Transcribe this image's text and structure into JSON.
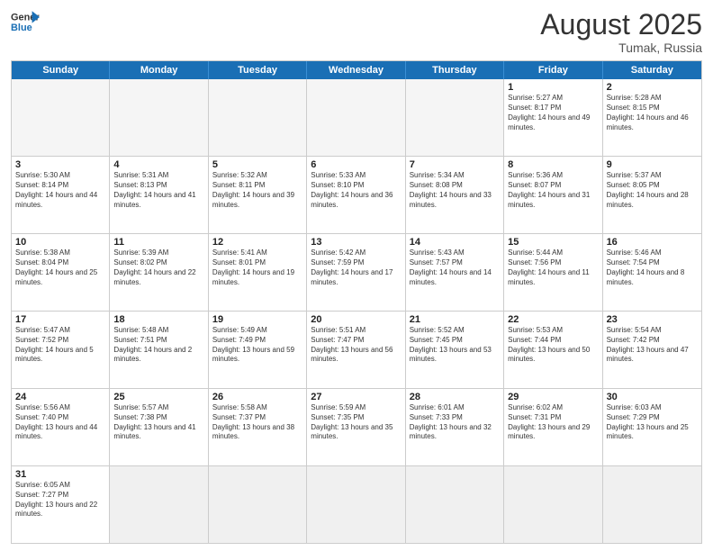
{
  "header": {
    "logo_general": "General",
    "logo_blue": "Blue",
    "month_title": "August 2025",
    "location": "Tumak, Russia"
  },
  "days_of_week": [
    "Sunday",
    "Monday",
    "Tuesday",
    "Wednesday",
    "Thursday",
    "Friday",
    "Saturday"
  ],
  "weeks": [
    [
      {
        "day": "",
        "info": ""
      },
      {
        "day": "",
        "info": ""
      },
      {
        "day": "",
        "info": ""
      },
      {
        "day": "",
        "info": ""
      },
      {
        "day": "",
        "info": ""
      },
      {
        "day": "1",
        "info": "Sunrise: 5:27 AM\nSunset: 8:17 PM\nDaylight: 14 hours and 49 minutes."
      },
      {
        "day": "2",
        "info": "Sunrise: 5:28 AM\nSunset: 8:15 PM\nDaylight: 14 hours and 46 minutes."
      }
    ],
    [
      {
        "day": "3",
        "info": "Sunrise: 5:30 AM\nSunset: 8:14 PM\nDaylight: 14 hours and 44 minutes."
      },
      {
        "day": "4",
        "info": "Sunrise: 5:31 AM\nSunset: 8:13 PM\nDaylight: 14 hours and 41 minutes."
      },
      {
        "day": "5",
        "info": "Sunrise: 5:32 AM\nSunset: 8:11 PM\nDaylight: 14 hours and 39 minutes."
      },
      {
        "day": "6",
        "info": "Sunrise: 5:33 AM\nSunset: 8:10 PM\nDaylight: 14 hours and 36 minutes."
      },
      {
        "day": "7",
        "info": "Sunrise: 5:34 AM\nSunset: 8:08 PM\nDaylight: 14 hours and 33 minutes."
      },
      {
        "day": "8",
        "info": "Sunrise: 5:36 AM\nSunset: 8:07 PM\nDaylight: 14 hours and 31 minutes."
      },
      {
        "day": "9",
        "info": "Sunrise: 5:37 AM\nSunset: 8:05 PM\nDaylight: 14 hours and 28 minutes."
      }
    ],
    [
      {
        "day": "10",
        "info": "Sunrise: 5:38 AM\nSunset: 8:04 PM\nDaylight: 14 hours and 25 minutes."
      },
      {
        "day": "11",
        "info": "Sunrise: 5:39 AM\nSunset: 8:02 PM\nDaylight: 14 hours and 22 minutes."
      },
      {
        "day": "12",
        "info": "Sunrise: 5:41 AM\nSunset: 8:01 PM\nDaylight: 14 hours and 19 minutes."
      },
      {
        "day": "13",
        "info": "Sunrise: 5:42 AM\nSunset: 7:59 PM\nDaylight: 14 hours and 17 minutes."
      },
      {
        "day": "14",
        "info": "Sunrise: 5:43 AM\nSunset: 7:57 PM\nDaylight: 14 hours and 14 minutes."
      },
      {
        "day": "15",
        "info": "Sunrise: 5:44 AM\nSunset: 7:56 PM\nDaylight: 14 hours and 11 minutes."
      },
      {
        "day": "16",
        "info": "Sunrise: 5:46 AM\nSunset: 7:54 PM\nDaylight: 14 hours and 8 minutes."
      }
    ],
    [
      {
        "day": "17",
        "info": "Sunrise: 5:47 AM\nSunset: 7:52 PM\nDaylight: 14 hours and 5 minutes."
      },
      {
        "day": "18",
        "info": "Sunrise: 5:48 AM\nSunset: 7:51 PM\nDaylight: 14 hours and 2 minutes."
      },
      {
        "day": "19",
        "info": "Sunrise: 5:49 AM\nSunset: 7:49 PM\nDaylight: 13 hours and 59 minutes."
      },
      {
        "day": "20",
        "info": "Sunrise: 5:51 AM\nSunset: 7:47 PM\nDaylight: 13 hours and 56 minutes."
      },
      {
        "day": "21",
        "info": "Sunrise: 5:52 AM\nSunset: 7:45 PM\nDaylight: 13 hours and 53 minutes."
      },
      {
        "day": "22",
        "info": "Sunrise: 5:53 AM\nSunset: 7:44 PM\nDaylight: 13 hours and 50 minutes."
      },
      {
        "day": "23",
        "info": "Sunrise: 5:54 AM\nSunset: 7:42 PM\nDaylight: 13 hours and 47 minutes."
      }
    ],
    [
      {
        "day": "24",
        "info": "Sunrise: 5:56 AM\nSunset: 7:40 PM\nDaylight: 13 hours and 44 minutes."
      },
      {
        "day": "25",
        "info": "Sunrise: 5:57 AM\nSunset: 7:38 PM\nDaylight: 13 hours and 41 minutes."
      },
      {
        "day": "26",
        "info": "Sunrise: 5:58 AM\nSunset: 7:37 PM\nDaylight: 13 hours and 38 minutes."
      },
      {
        "day": "27",
        "info": "Sunrise: 5:59 AM\nSunset: 7:35 PM\nDaylight: 13 hours and 35 minutes."
      },
      {
        "day": "28",
        "info": "Sunrise: 6:01 AM\nSunset: 7:33 PM\nDaylight: 13 hours and 32 minutes."
      },
      {
        "day": "29",
        "info": "Sunrise: 6:02 AM\nSunset: 7:31 PM\nDaylight: 13 hours and 29 minutes."
      },
      {
        "day": "30",
        "info": "Sunrise: 6:03 AM\nSunset: 7:29 PM\nDaylight: 13 hours and 25 minutes."
      }
    ],
    [
      {
        "day": "31",
        "info": "Sunrise: 6:05 AM\nSunset: 7:27 PM\nDaylight: 13 hours and 22 minutes."
      },
      {
        "day": "",
        "info": ""
      },
      {
        "day": "",
        "info": ""
      },
      {
        "day": "",
        "info": ""
      },
      {
        "day": "",
        "info": ""
      },
      {
        "day": "",
        "info": ""
      },
      {
        "day": "",
        "info": ""
      }
    ]
  ]
}
